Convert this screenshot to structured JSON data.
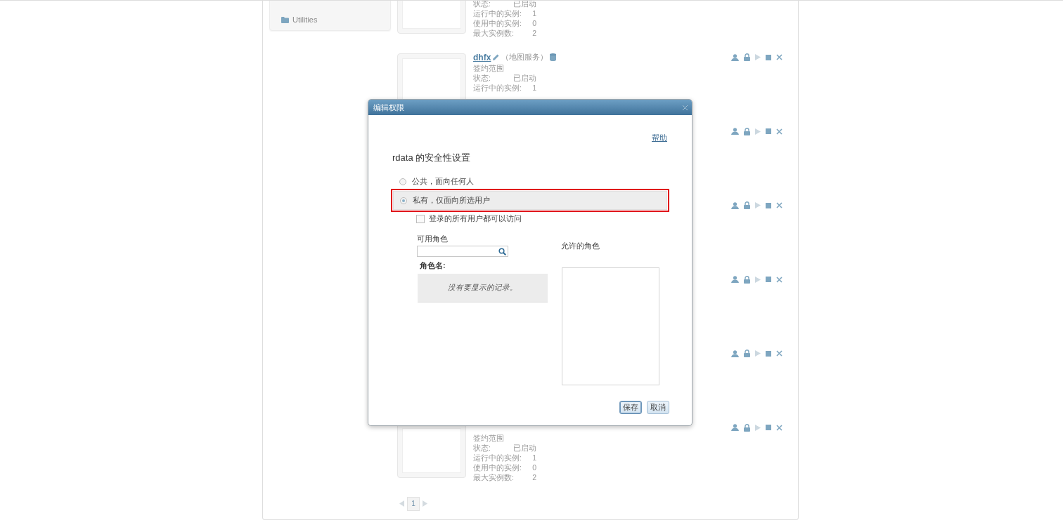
{
  "sidebar": {
    "items": [
      {
        "label": "Utilities"
      }
    ]
  },
  "services": [
    {
      "details": [
        {
          "label": "状态:",
          "value": "已启动"
        },
        {
          "label": "运行中的实例:",
          "value": "1"
        },
        {
          "label": "使用中的实例:",
          "value": "0"
        },
        {
          "label": "最大实例数:",
          "value": "2"
        }
      ]
    },
    {
      "name": "dhfx",
      "type": "（地图服务）",
      "scope": "签约范围",
      "details": [
        {
          "label": "状态:",
          "value": "已启动"
        },
        {
          "label": "运行中的实例:",
          "value": "1"
        }
      ],
      "start_enabled": false
    },
    {
      "start_enabled": false
    },
    {
      "start_enabled": false
    },
    {
      "start_enabled": false
    },
    {
      "start_enabled": false
    },
    {
      "scope": "签约范围",
      "details": [
        {
          "label": "状态:",
          "value": "已启动"
        },
        {
          "label": "运行中的实例:",
          "value": "1"
        },
        {
          "label": "使用中的实例:",
          "value": "0"
        },
        {
          "label": "最大实例数:",
          "value": "2"
        }
      ],
      "start_enabled": false
    }
  ],
  "pagination": {
    "pages": [
      {
        "label": "1",
        "selected": true
      }
    ]
  },
  "dialog": {
    "title": "编辑权限",
    "help": "帮助",
    "heading": "rdata 的安全性设置",
    "options": [
      {
        "label": "公共，面向任何人",
        "selected": false,
        "annotated": false
      },
      {
        "label": "私有，仅面向所选用户",
        "selected": true,
        "annotated": true
      }
    ],
    "all_logged_in": {
      "label": "登录的所有用户都可以访问",
      "checked": false
    },
    "available": {
      "label": "可用角色",
      "column": "角色名:",
      "empty": "没有要显示的记录。"
    },
    "allowed": {
      "label": "允许的角色"
    },
    "buttons": [
      {
        "label": "保存",
        "focused": true
      },
      {
        "label": "取消",
        "focused": false
      }
    ]
  }
}
